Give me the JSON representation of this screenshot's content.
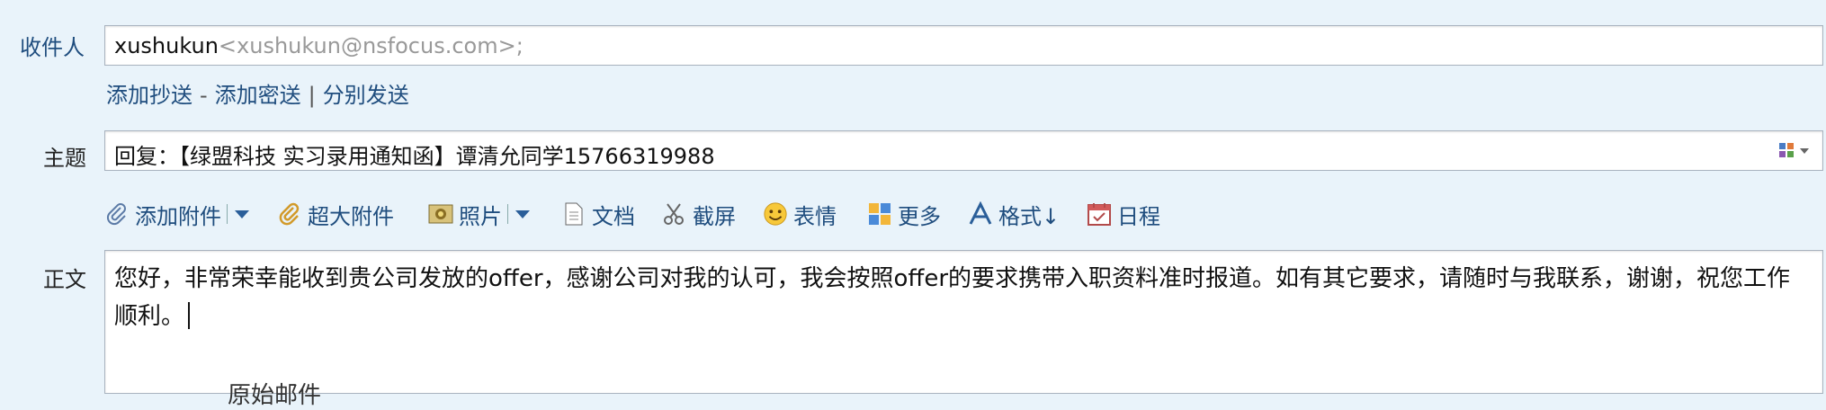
{
  "labels": {
    "to": "收件人",
    "subject": "主题",
    "body": "正文"
  },
  "recipient": {
    "name": "xushukun",
    "address": "<xushukun@nsfocus.com>;"
  },
  "cc_links": {
    "add_cc": "添加抄送",
    "dash": "-",
    "add_bcc": "添加密送",
    "pipe": "|",
    "separate_send": "分别发送"
  },
  "subject": {
    "value": "回复：【绿盟科技  实习录用通知函】谭清允同学15766319988"
  },
  "toolbar": {
    "attach": "添加附件",
    "large_attach": "超大附件",
    "photo": "照片",
    "document": "文档",
    "screenshot": "截屏",
    "emoji": "表情",
    "more": "更多",
    "format": "格式↓",
    "schedule": "日程"
  },
  "body": {
    "text": "您好，非常荣幸能收到贵公司发放的offer，感谢公司对我的认可，我会按照offer的要求携带入职资料准时报道。如有其它要求，请随时与我联系，谢谢，祝您工作顺利。",
    "original_header": "原始邮件"
  },
  "colors": {
    "label_blue": "#1f4d7e",
    "background": "#e9f3fa",
    "field_border": "#a9b3bf"
  }
}
